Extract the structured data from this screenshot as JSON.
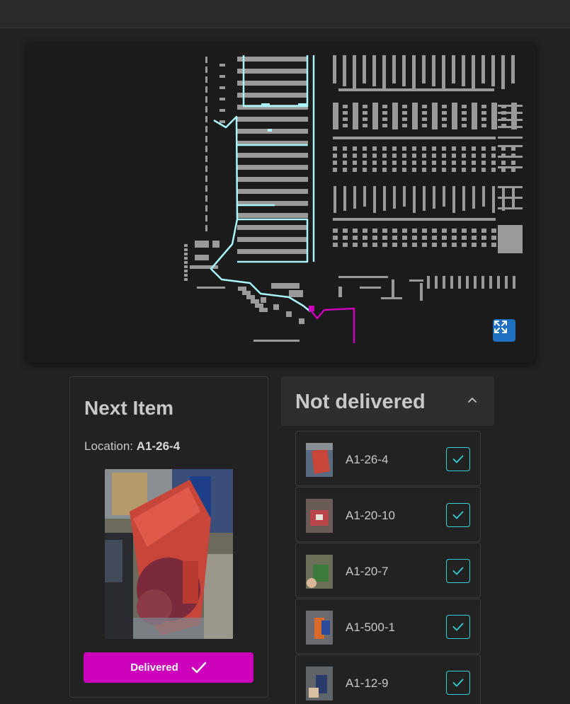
{
  "next_item": {
    "title": "Next Item",
    "location_label": "Location:",
    "location_value": "A1-26-4",
    "delivered_label": "Delivered"
  },
  "not_delivered": {
    "title": "Not delivered",
    "items": [
      {
        "label": "A1-26-4"
      },
      {
        "label": "A1-20-10"
      },
      {
        "label": "A1-20-7"
      },
      {
        "label": "A1-500-1"
      },
      {
        "label": "A1-12-9"
      }
    ]
  },
  "colors": {
    "accent_magenta": "#cc00bb",
    "route_cyan": "#a8f4f8",
    "check_teal": "#35d0d8",
    "expand_blue": "#1e6fc0"
  }
}
